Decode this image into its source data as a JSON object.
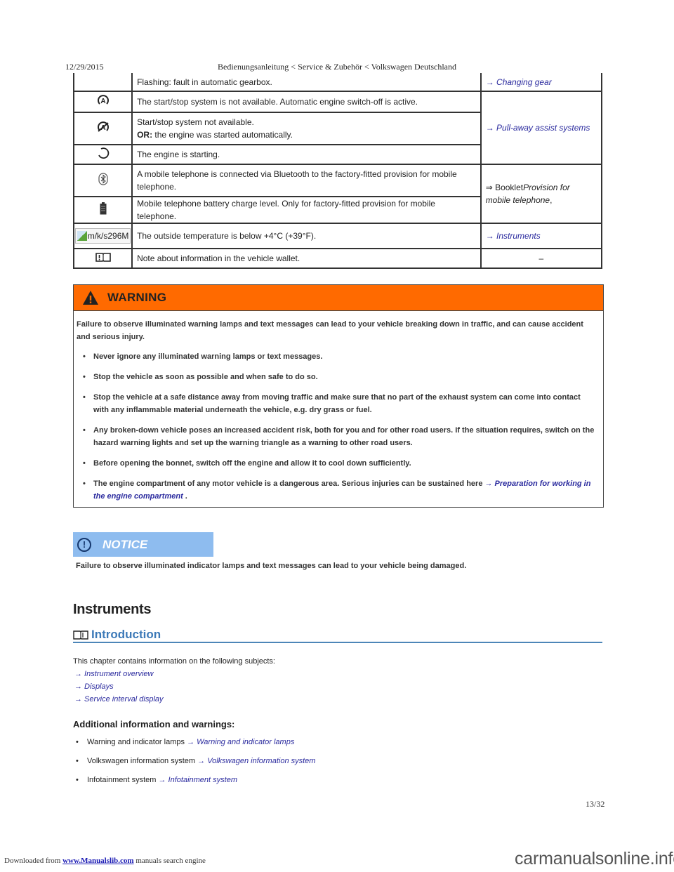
{
  "header": {
    "date": "12/29/2015",
    "title": "Bedienungsanleitung < Service & Zubehör < Volkswagen Deutschland"
  },
  "lamp_table": {
    "rows": [
      {
        "icon": "none",
        "description": "Flashing: fault in automatic gearbox.",
        "reference": "→ Changing gear"
      },
      {
        "icon": "start-stop-icon",
        "description": "The start/stop system is not available. Automatic engine switch-off is active.",
        "reference": "→ Pull-away assist systems"
      },
      {
        "icon": "start-stop-crossed-icon",
        "description_line1": "Start/stop system not available.",
        "description_or_label": "OR:",
        "description_line2": " the engine was started automatically."
      },
      {
        "icon": "engine-starting-icon",
        "description": "The engine is starting."
      },
      {
        "icon": "bluetooth-icon",
        "description": "A mobile telephone is connected via Bluetooth to the factory-fitted provision for mobile telephone.",
        "reference_prefix": "⇒ Booklet",
        "reference_italic": "Provision for mobile telephone",
        "reference_suffix": ","
      },
      {
        "icon": "battery-icon",
        "description": "Mobile telephone battery charge level. Only for factory-fitted provision for mobile telephone."
      },
      {
        "icon": "broken-image-icon",
        "icon_alt_text": "m/k/s296M",
        "description": "The outside temperature is below +4°C (+39°F).",
        "reference": "→ Instruments"
      },
      {
        "icon": "book-exclamation-icon",
        "description": "Note about information in the vehicle wallet.",
        "reference": "–"
      }
    ]
  },
  "warning": {
    "label": "WARNING",
    "color": "#ff6a00",
    "intro": "Failure to observe illuminated warning lamps and text messages can lead to your vehicle breaking down in traffic, and can cause accident and serious injury.",
    "items": [
      "Never ignore any illuminated warning lamps or text messages.",
      "Stop the vehicle as soon as possible and when safe to do so.",
      "Stop the vehicle at a safe distance away from moving traffic and make sure that no part of the exhaust system can come into contact with any inflammable material underneath the vehicle, e.g. dry grass or fuel.",
      "Any broken-down vehicle poses an increased accident risk, both for you and for other road users. If the situation requires, switch on the hazard warning lights and set up the warning triangle as a warning to other road users.",
      "Before opening the bonnet, switch off the engine and allow it to cool down sufficiently."
    ],
    "last_item_text": "The engine compartment of any motor vehicle is a dangerous area. Serious injuries can be sustained here ",
    "last_item_link": "→ Preparation for working in the engine compartment",
    "last_item_suffix": " ."
  },
  "notice": {
    "label": "NOTICE",
    "color": "#8ebcef",
    "text": "Failure to observe illuminated indicator lamps and text messages can lead to your vehicle being damaged."
  },
  "section": {
    "title": "Instruments",
    "subtitle": "Introduction",
    "intro": "This chapter contains information on the following subjects:",
    "links": [
      "→ Instrument overview",
      "→ Displays",
      "→ Service interval display"
    ],
    "additional_title": "Additional information and warnings:",
    "additional": [
      {
        "text": "Warning and indicator lamps ",
        "link": "→ Warning and indicator lamps"
      },
      {
        "text": "Volkswagen information system ",
        "link": "→ Volkswagen information system"
      },
      {
        "text": "Infotainment system ",
        "link": "→ Infotainment system"
      }
    ]
  },
  "page_number": "13/32",
  "footer": {
    "prefix": "Downloaded from ",
    "link": "www.Manualslib.com",
    "suffix": " manuals search engine",
    "watermark": "carmanualsonline.info"
  }
}
